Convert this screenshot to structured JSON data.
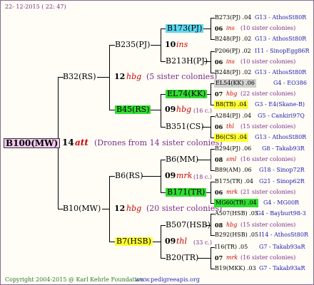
{
  "header": {
    "date": "22- 12-2015 ( 22: 47)"
  },
  "footer": {
    "copyright": "Copyright 2004-2015 @ Karl Kehrle Foundation.",
    "site": "www.pedigreeapis.org"
  },
  "root": {
    "name": "B100(MW)",
    "year": "14",
    "code": "att",
    "note": "(Drones from 14 sister colonies)"
  },
  "gen1": [
    {
      "name": "B32(RS)",
      "year": "12",
      "code": "hbg",
      "note": "(5 sister colonies)"
    },
    {
      "name": "B10(MW)",
      "year": "12",
      "code": "hbg",
      "note": "(20 sister colonies)"
    }
  ],
  "gen2": [
    {
      "name": "B235(PJ)",
      "year": "10",
      "code": "ins"
    },
    {
      "name": "B45(RS)",
      "year": "09",
      "code": "hbg",
      "note": "(16 c.)"
    },
    {
      "name": "B6(RS)",
      "year": "09",
      "code": "mrk",
      "note": "(18 c.)"
    },
    {
      "name": "B7(HSB)",
      "year": "09",
      "code": "thl",
      "note": "(33 c.)"
    }
  ],
  "gen3": [
    {
      "name": "B173(PJ)"
    },
    {
      "name": "B213H(PJ)"
    },
    {
      "name": "EL74(KK)"
    },
    {
      "name": "B351(CS)"
    },
    {
      "name": "B6(MM)"
    },
    {
      "name": "B171(TR)"
    },
    {
      "name": "B507(HSB)"
    },
    {
      "name": "B20(TR)"
    }
  ],
  "gen4": [
    {
      "row": "B273(PJ) .04",
      "src": "G13 - AthosSt80R"
    },
    {
      "year": "06",
      "code": "ins",
      "note": "(10 sister colonies)"
    },
    {
      "row": "B248(PJ) .02",
      "src": "G13 - AthosSt80R"
    },
    {
      "row": "P206(PJ) .02",
      "src": "I11 - SinopEgg86R"
    },
    {
      "year": "06",
      "code": "ins",
      "note": "(10 sister colonies)"
    },
    {
      "row": "B248(PJ) .02",
      "src": "G13 - AthosSt80R"
    },
    {
      "row": "EL54(KK) .06",
      "src": "G4 - EO386"
    },
    {
      "year": "07",
      "code": "hbg",
      "note": "(22 sister colonies)"
    },
    {
      "row": "B8(TB) .04",
      "src": "G3 - E4(Skane-B)"
    },
    {
      "row": "A284(PJ) .04",
      "src": "G5 - Cankiri97Q"
    },
    {
      "year": "06",
      "code": "thl",
      "note": "(15 sister colonies)"
    },
    {
      "row": "B6(CS) .04",
      "src": "G13 - AthosSt80R"
    },
    {
      "row": "B294(PJ) .06",
      "src": "G8 - Takab93R"
    },
    {
      "year": "08",
      "code": "sml",
      "note": "(16 sister colonies)"
    },
    {
      "row": "B89(AM) .06",
      "src": "G18 - Sinop72R"
    },
    {
      "row": "B175(TR) .04",
      "src": "G21 - Sinop62R"
    },
    {
      "year": "06",
      "code": "mrk",
      "note": "(21 sister colonies)"
    },
    {
      "row": "MG60(TR) .04",
      "src": "G4 - MG00R"
    },
    {
      "row": "A507(HSB) .05",
      "src": "G4 - Bayburt98-3"
    },
    {
      "year": "08",
      "code": "hbg",
      "note": "(15 sister colonies)"
    },
    {
      "row": "B292(HSB) .05",
      "src": "I14 - AthosSt80R"
    },
    {
      "row": "I16(TR) .05",
      "src": "G7 - Takab93aR"
    },
    {
      "year": "07",
      "code": "mrk",
      "note": "(16 sister colonies)"
    },
    {
      "row": "B19(MKK) .03",
      "src": "G7 - Takab93aR"
    }
  ],
  "colors": {
    "cyan": "#5fd7ef",
    "green": "#33dd33",
    "yellow": "#ffff33",
    "rootbg": "#f4c8f0",
    "gray": "#cfcfcf"
  }
}
